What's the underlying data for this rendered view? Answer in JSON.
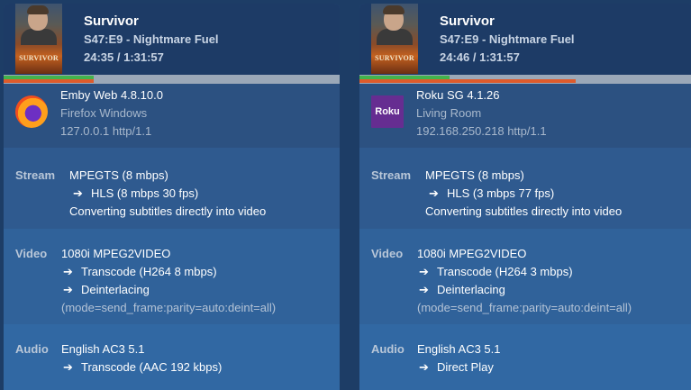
{
  "sessions": [
    {
      "poster_text": "SURVIVOR",
      "title": "Survivor",
      "episode": "S47:E9 - Nightmare Fuel",
      "progress_text": "24:35 / 1:31:57",
      "progress": {
        "played_fraction": 0.268,
        "buffered_fraction": 0.268
      },
      "client": {
        "icon": "firefox-icon",
        "name": "Emby Web 4.8.10.0",
        "sub": "Firefox Windows",
        "address": "127.0.0.1 http/1.1"
      },
      "stream": {
        "label": "Stream",
        "lines": [
          "MPEGTS (8 mbps)",
          "HLS (8 mbps 30 fps)",
          "Converting subtitles directly into video"
        ]
      },
      "video": {
        "label": "Video",
        "lines": [
          "1080i MPEG2VIDEO",
          "Transcode (H264 8 mbps)",
          "Deinterlacing",
          "(mode=send_frame:parity=auto:deint=all)"
        ]
      },
      "audio": {
        "label": "Audio",
        "lines": [
          "English AC3 5.1",
          "Transcode (AAC 192 kbps)"
        ]
      }
    },
    {
      "poster_text": "SURVIVOR",
      "title": "Survivor",
      "episode": "S47:E9 - Nightmare Fuel",
      "progress_text": "24:46 / 1:31:57",
      "progress": {
        "played_fraction": 0.269,
        "buffered_fraction": 0.645
      },
      "client": {
        "icon_text": "Roku",
        "name": "Roku SG 4.1.26",
        "sub": "Living Room",
        "address": "192.168.250.218 http/1.1"
      },
      "stream": {
        "label": "Stream",
        "lines": [
          "MPEGTS (8 mbps)",
          "HLS (3 mbps 77 fps)",
          "Converting subtitles directly into video"
        ]
      },
      "video": {
        "label": "Video",
        "lines": [
          "1080i MPEG2VIDEO",
          "Transcode (H264 3 mbps)",
          "Deinterlacing",
          "(mode=send_frame:parity=auto:deint=all)"
        ]
      },
      "audio": {
        "label": "Audio",
        "lines": [
          "English AC3 5.1",
          "Direct Play"
        ]
      }
    }
  ],
  "arrow_glyph": "➔",
  "colors": {
    "played": "#43b34c",
    "buffered": "#de5b2c",
    "track": "#9ba8b8"
  }
}
